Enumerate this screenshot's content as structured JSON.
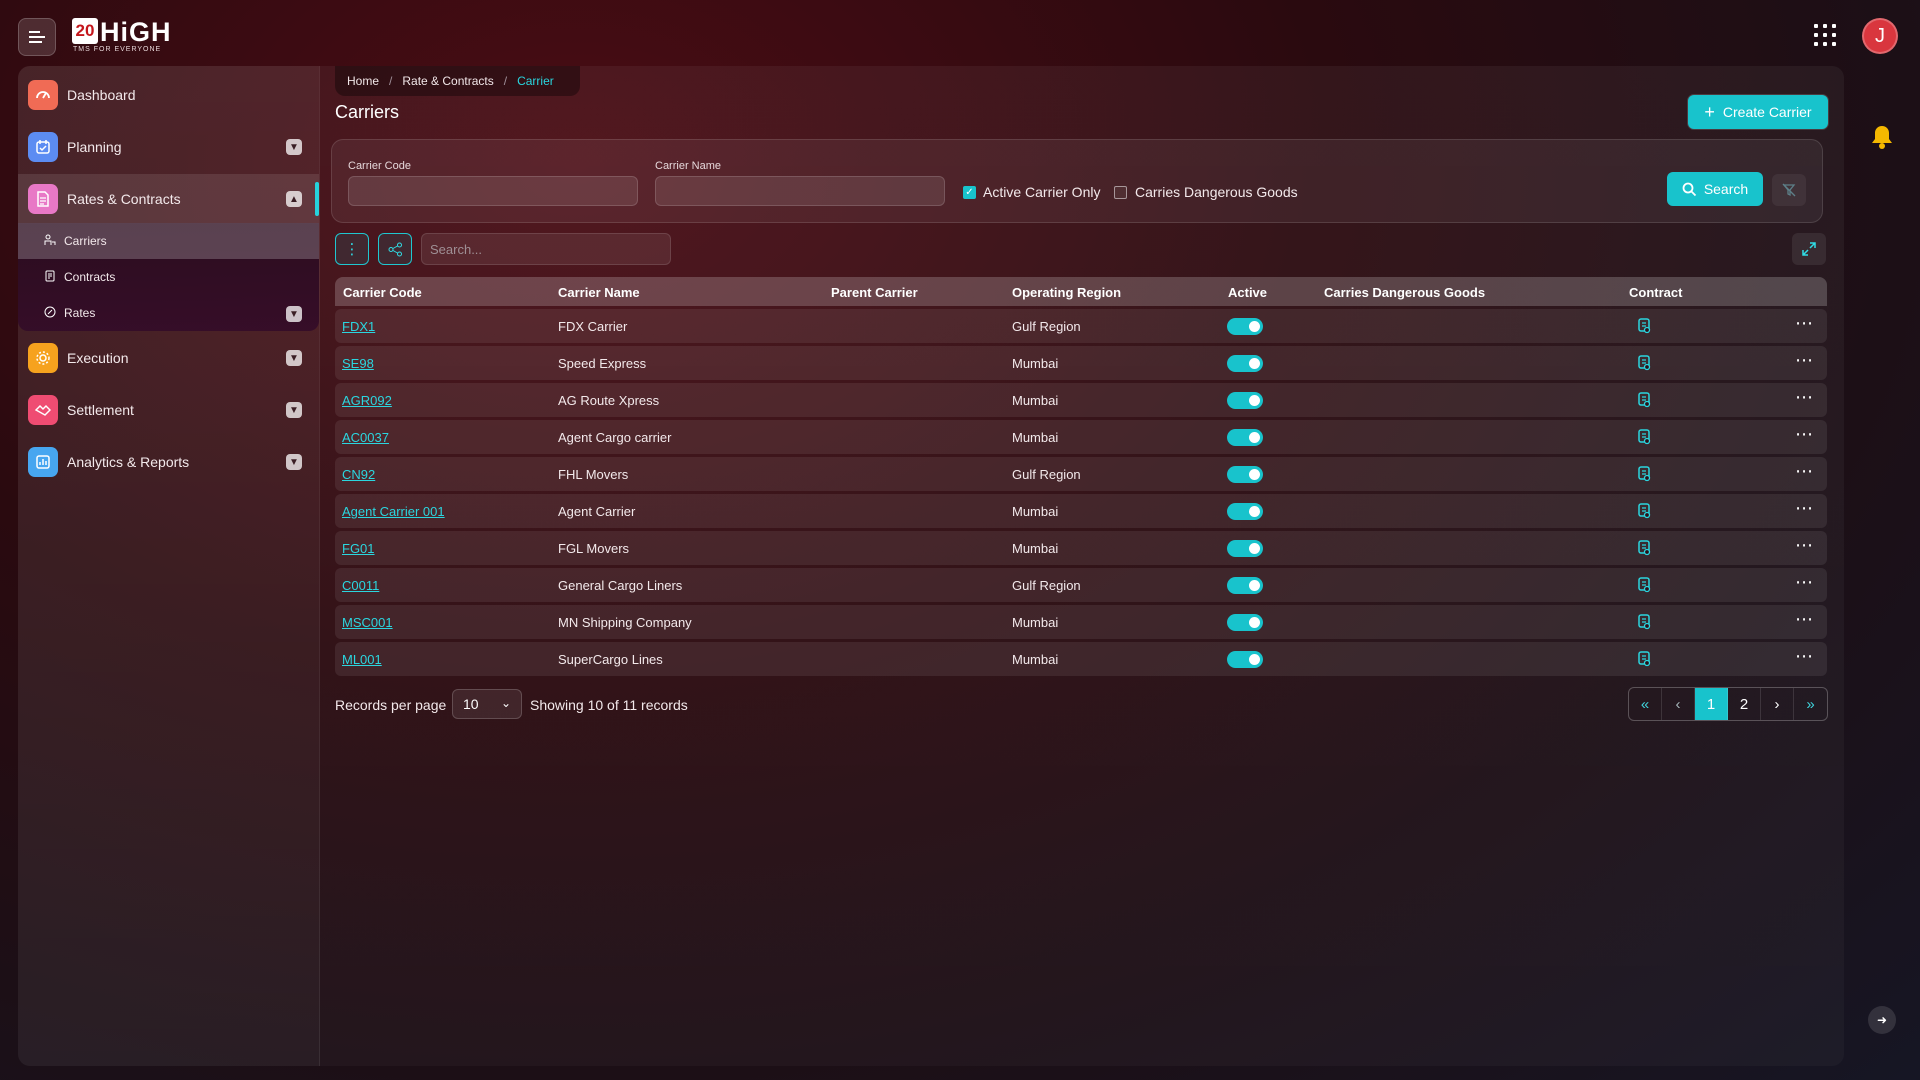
{
  "brand": {
    "logo_badge": "20",
    "logo_text": "HiGH",
    "tagline": "TMS FOR EVERYONE"
  },
  "user": {
    "initial": "J"
  },
  "sidebar": {
    "items": [
      {
        "label": "Dashboard",
        "icon": "gauge-icon",
        "color": "#f06b55"
      },
      {
        "label": "Planning",
        "icon": "calendar-icon",
        "color": "#5c8cf2"
      },
      {
        "label": "Rates & Contracts",
        "icon": "document-icon",
        "color": "#e878c6"
      },
      {
        "label": "Execution",
        "icon": "gear-icon",
        "color": "#f6a21e"
      },
      {
        "label": "Settlement",
        "icon": "handshake-icon",
        "color": "#ef4c72"
      },
      {
        "label": "Analytics & Reports",
        "icon": "chart-icon",
        "color": "#47a6f0"
      }
    ],
    "sub_items": [
      {
        "label": "Carriers",
        "icon": "carrier-icon"
      },
      {
        "label": "Contracts",
        "icon": "contract-icon"
      },
      {
        "label": "Rates",
        "icon": "rate-icon"
      }
    ]
  },
  "breadcrumb": {
    "home": "Home",
    "parent": "Rate & Contracts",
    "current": "Carrier"
  },
  "page": {
    "title": "Carriers",
    "create_label": "Create Carrier"
  },
  "filters": {
    "carrier_code_label": "Carrier Code",
    "carrier_code_value": "",
    "carrier_name_label": "Carrier Name",
    "carrier_name_value": "",
    "active_only_label": "Active Carrier Only",
    "active_only_checked": true,
    "dangerous_label": "Carries Dangerous Goods",
    "dangerous_checked": false,
    "search_label": "Search"
  },
  "toolbar": {
    "search_placeholder": "Search..."
  },
  "table": {
    "columns": [
      "Carrier Code",
      "Carrier Name",
      "Parent Carrier",
      "Operating Region",
      "Active",
      "Carries Dangerous Goods",
      "Contract"
    ],
    "rows": [
      {
        "code": "FDX1",
        "name": "FDX Carrier",
        "parent": "",
        "region": "Gulf Region",
        "active": true,
        "dangerous": ""
      },
      {
        "code": "SE98",
        "name": "Speed Express",
        "parent": "",
        "region": "Mumbai",
        "active": true,
        "dangerous": ""
      },
      {
        "code": "AGR092",
        "name": "AG Route Xpress",
        "parent": "",
        "region": "Mumbai",
        "active": true,
        "dangerous": ""
      },
      {
        "code": "AC0037",
        "name": "Agent Cargo carrier",
        "parent": "",
        "region": "Mumbai",
        "active": true,
        "dangerous": ""
      },
      {
        "code": "CN92",
        "name": "FHL Movers",
        "parent": "",
        "region": "Gulf Region",
        "active": true,
        "dangerous": ""
      },
      {
        "code": "Agent Carrier 001",
        "name": "Agent Carrier",
        "parent": "",
        "region": "Mumbai",
        "active": true,
        "dangerous": ""
      },
      {
        "code": "FG01",
        "name": "FGL Movers",
        "parent": "",
        "region": "Mumbai",
        "active": true,
        "dangerous": ""
      },
      {
        "code": "C0011",
        "name": "General Cargo Liners",
        "parent": "",
        "region": "Gulf Region",
        "active": true,
        "dangerous": ""
      },
      {
        "code": "MSC001",
        "name": "MN Shipping Company",
        "parent": "",
        "region": "Mumbai",
        "active": true,
        "dangerous": ""
      },
      {
        "code": "ML001",
        "name": "SuperCargo Lines",
        "parent": "",
        "region": "Mumbai",
        "active": true,
        "dangerous": ""
      }
    ]
  },
  "footer": {
    "per_page_label": "Records per page",
    "per_page_value": "10",
    "showing_text": "Showing 10 of 11 records",
    "pages": [
      "1",
      "2"
    ],
    "current_page": "1"
  },
  "colors": {
    "accent": "#18c3cc",
    "link": "#2bd6df",
    "avatar": "#d9363e",
    "bell": "#f5b800"
  }
}
